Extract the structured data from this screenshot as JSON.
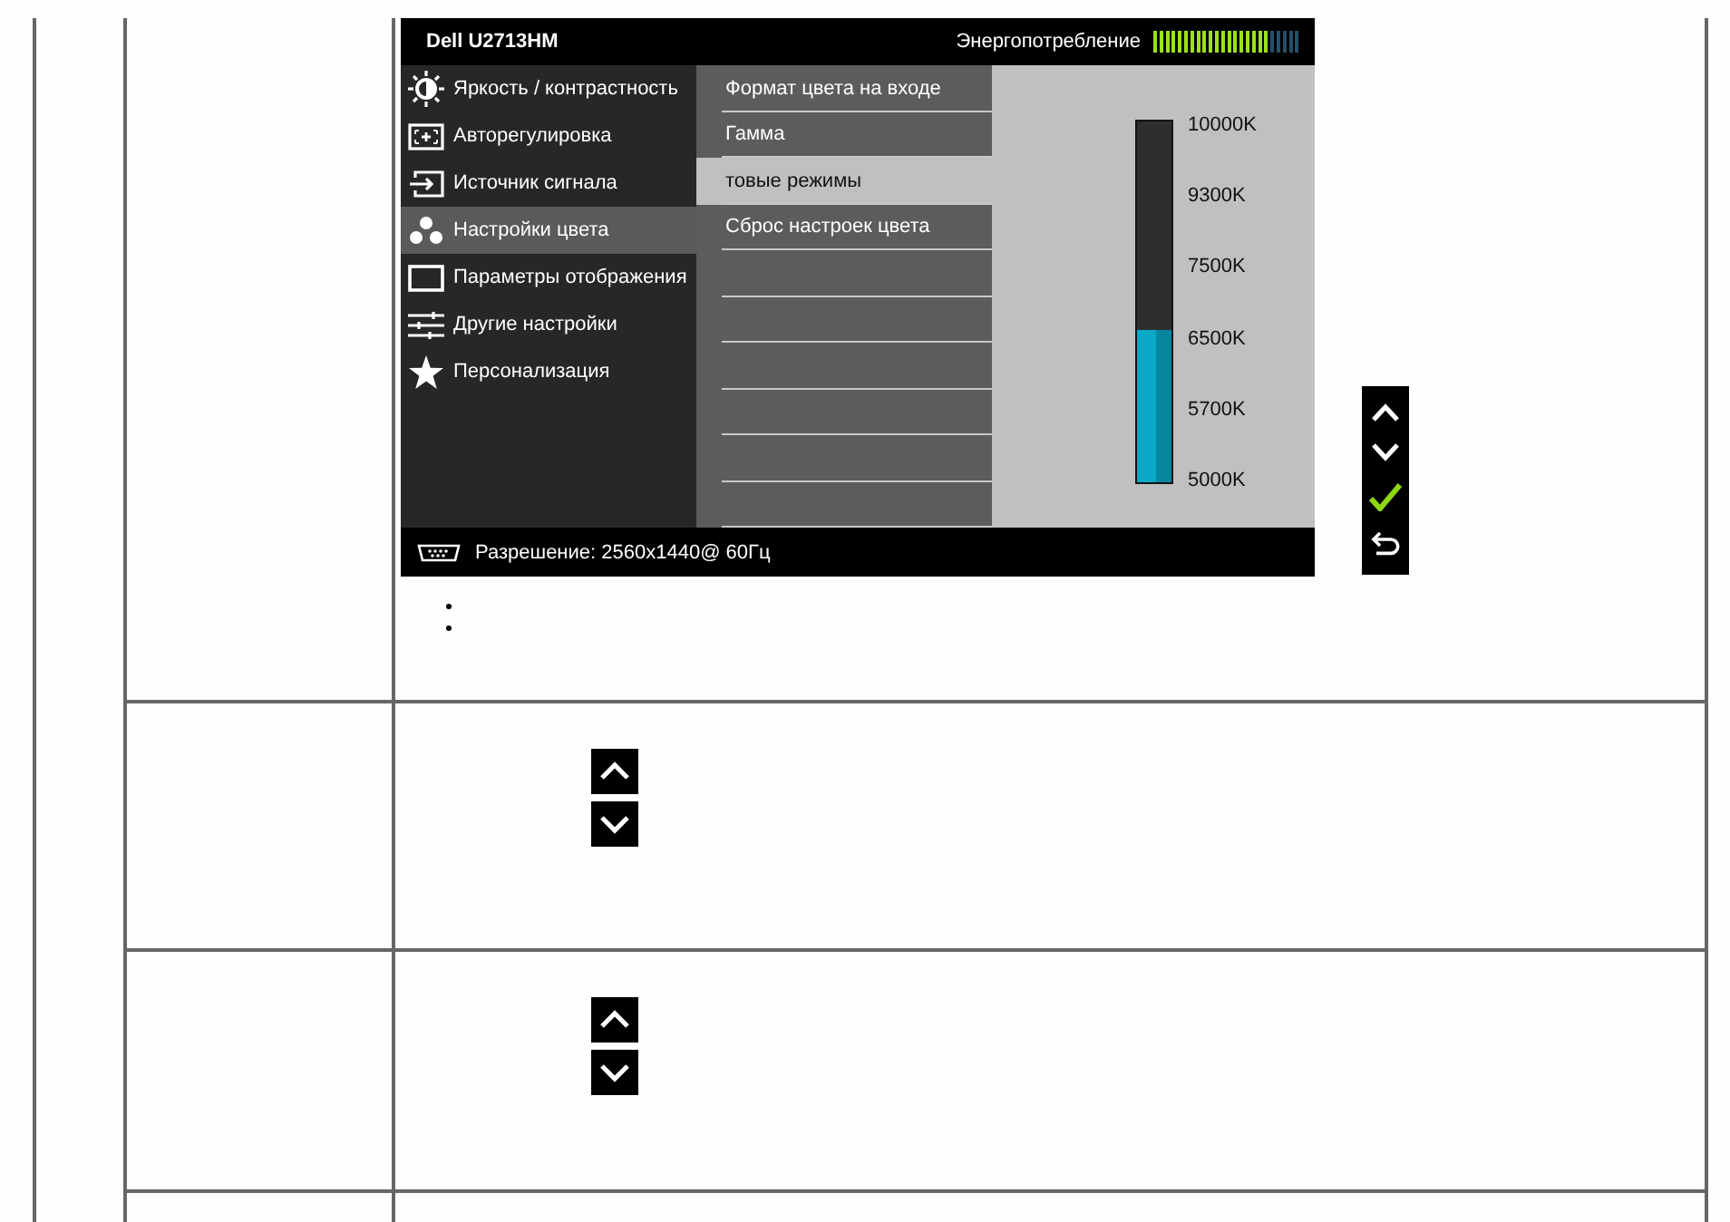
{
  "osd": {
    "model": "Dell U2713HM",
    "power_label": "Энергопотребление",
    "power_meter": {
      "level": 0.8
    },
    "menu": [
      {
        "label": "Яркость / контрастность",
        "selected": false
      },
      {
        "label": "Авторегулировка",
        "selected": false
      },
      {
        "label": "Источник сигнала",
        "selected": false
      },
      {
        "label": "Настройки цвета",
        "selected": true
      },
      {
        "label": "Параметры отображения",
        "selected": false
      },
      {
        "label": "Другие настройки",
        "selected": false
      },
      {
        "label": "Персонализация",
        "selected": false
      }
    ],
    "submenu": [
      {
        "label": "Формат цвета на входе",
        "selected": false
      },
      {
        "label": "Гамма",
        "selected": false
      },
      {
        "label": "товые режимы",
        "selected": true
      },
      {
        "label": "Сброс настроек цвета",
        "selected": false
      }
    ],
    "color_temperature": {
      "level": 0.42,
      "scale": [
        "10000K",
        "9300K",
        "7500K",
        "6500K",
        "5700K",
        "5000K"
      ]
    },
    "status": "Разрешение: 2560x1440@ 60Гц"
  }
}
